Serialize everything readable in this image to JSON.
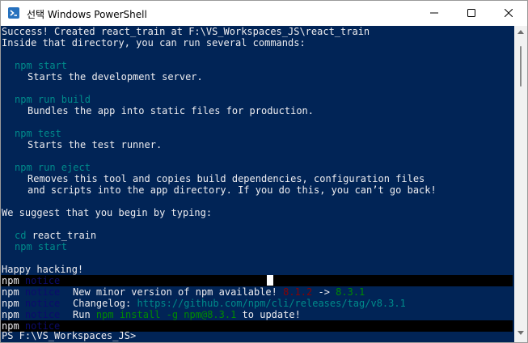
{
  "window": {
    "title": "선택 Windows PowerShell",
    "icon": "powershell-icon"
  },
  "titlebar_buttons": {
    "minimize": "minimize-icon",
    "maximize": "maximize-icon",
    "close": "close-icon"
  },
  "terminal": {
    "l1": "Success! Created react_train at F:\\VS_Workspaces_JS\\react_train",
    "l2": "Inside that directory, you can run several commands:",
    "cmd_start": "npm start",
    "desc_start": "Starts the development server.",
    "cmd_build": "npm run build",
    "desc_build": "Bundles the app into static files for production.",
    "cmd_test": "npm test",
    "desc_test": "Starts the test runner.",
    "cmd_eject": "npm run eject",
    "desc_eject_1": "Removes this tool and copies build dependencies, configuration files",
    "desc_eject_2": "and scripts into the app directory. If you do this, you can’t go back!",
    "suggest": "We suggest that you begin by typing:",
    "cd": "cd",
    "cd_arg": "react_train",
    "npm_start": "npm start",
    "happy": "Happy hacking!",
    "notice_npm": "npm",
    "notice_word": "notice",
    "notice_minor_text": "New minor version of npm available!",
    "notice_old_version": "8.1.2",
    "notice_arrow": "->",
    "notice_new_version": "8.3.1",
    "notice_changelog_label": "Changelog:",
    "notice_changelog_url": "https://github.com/npm/cli/releases/tag/v8.3.1",
    "notice_run": "Run",
    "notice_run_cmd": "npm install -g npm@8.3.1",
    "notice_run_suffix": "to update!",
    "prompt": "PS F:\\VS_Workspaces_JS>"
  },
  "colors": {
    "background": "#012456",
    "foreground": "#eeedf0",
    "command": "#008b8b",
    "old_version": "#8b0000",
    "new_version": "#008b00"
  }
}
